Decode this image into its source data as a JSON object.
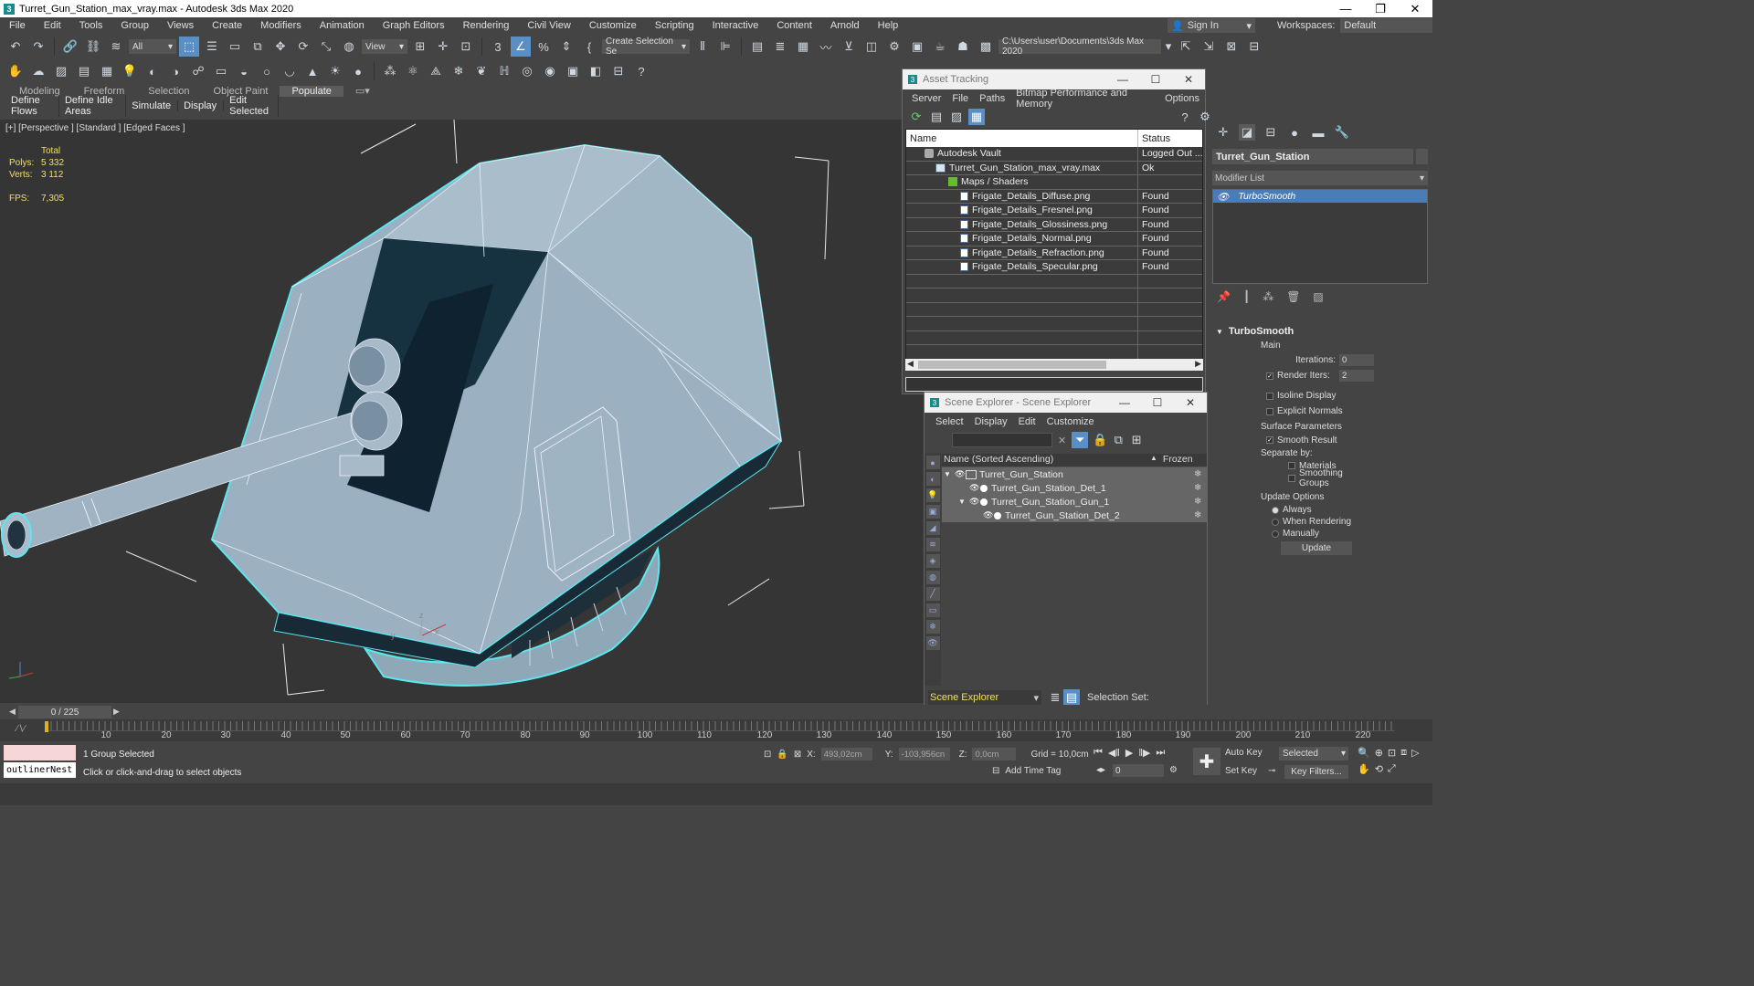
{
  "title_bar": {
    "app_icon": "3",
    "title": "Turret_Gun_Station_max_vray.max - Autodesk 3ds Max 2020",
    "min": "—",
    "restore": "❐",
    "close": "✕"
  },
  "menu": {
    "items": [
      "File",
      "Edit",
      "Tools",
      "Group",
      "Views",
      "Create",
      "Modifiers",
      "Animation",
      "Graph Editors",
      "Rendering",
      "Civil View",
      "Customize",
      "Scripting",
      "Interactive",
      "Content",
      "Arnold",
      "Help"
    ],
    "sign_in": "Sign In",
    "workspaces_label": "Workspaces:",
    "workspace_value": "Default"
  },
  "toolbar": {
    "selection_filter": "All",
    "ref_coord": "View",
    "named_selection": "Create Selection Se",
    "project_path": "C:\\Users\\user\\Documents\\3ds Max 2020"
  },
  "ribbon": {
    "tabs": [
      "Modeling",
      "Freeform",
      "Selection",
      "Object Paint",
      "Populate"
    ],
    "active_tab": "Populate",
    "sub_items": [
      "Define Flows",
      "Define Idle Areas",
      "Simulate",
      "Display",
      "Edit Selected"
    ]
  },
  "viewport": {
    "label": "[+] [Perspective ] [Standard ] [Edged Faces ]",
    "stats_header": "Total",
    "polys_label": "Polys:",
    "polys_value": "5 332",
    "verts_label": "Verts:",
    "verts_value": "3 112",
    "fps_label": "FPS:",
    "fps_value": "7,305",
    "axis_z": "z",
    "axis_x": "x",
    "axis_y": "y"
  },
  "asset_tracking": {
    "title": "Asset Tracking",
    "menu": [
      "Server",
      "File",
      "Paths",
      "Bitmap Performance and Memory",
      "Options"
    ],
    "col_name": "Name",
    "col_status": "Status",
    "rows": [
      {
        "name": "Autodesk Vault",
        "status": "Logged Out ..."
      },
      {
        "name": "Turret_Gun_Station_max_vray.max",
        "status": "Ok"
      },
      {
        "name": "Maps / Shaders",
        "status": ""
      },
      {
        "name": "Frigate_Details_Diffuse.png",
        "status": "Found"
      },
      {
        "name": "Frigate_Details_Fresnel.png",
        "status": "Found"
      },
      {
        "name": "Frigate_Details_Glossiness.png",
        "status": "Found"
      },
      {
        "name": "Frigate_Details_Normal.png",
        "status": "Found"
      },
      {
        "name": "Frigate_Details_Refraction.png",
        "status": "Found"
      },
      {
        "name": "Frigate_Details_Specular.png",
        "status": "Found"
      }
    ]
  },
  "scene_explorer": {
    "title": "Scene Explorer - Scene Explorer",
    "menu": [
      "Select",
      "Display",
      "Edit",
      "Customize"
    ],
    "col_name": "Name (Sorted Ascending)",
    "col_frozen": "Frozen",
    "rows": [
      {
        "name": "Turret_Gun_Station",
        "indent": 0
      },
      {
        "name": "Turret_Gun_Station_Det_1",
        "indent": 1
      },
      {
        "name": "Turret_Gun_Station_Gun_1",
        "indent": 1
      },
      {
        "name": "Turret_Gun_Station_Det_2",
        "indent": 2
      }
    ],
    "explorer_name": "Scene Explorer",
    "selection_set_label": "Selection Set:"
  },
  "command_panel": {
    "object_name": "Turret_Gun_Station",
    "modifier_list": "Modifier List",
    "stack_item": "TurboSmooth",
    "rollout_title": "TurboSmooth",
    "main_label": "Main",
    "iterations_label": "Iterations:",
    "iterations_value": "0",
    "render_iters_label": "Render Iters:",
    "render_iters_value": "2",
    "isoline_label": "Isoline Display",
    "explicit_label": "Explicit Normals",
    "surface_label": "Surface Parameters",
    "smooth_label": "Smooth Result",
    "separate_label": "Separate by:",
    "materials_label": "Materials",
    "smoothing_label": "Smoothing Groups",
    "update_options_label": "Update Options",
    "always_label": "Always",
    "when_rendering_label": "When Rendering",
    "manually_label": "Manually",
    "update_button": "Update"
  },
  "timeline": {
    "frame_display": "0 / 225",
    "labels": [
      "10",
      "20",
      "30",
      "40",
      "50",
      "60",
      "70",
      "80",
      "90",
      "100",
      "110",
      "120",
      "130",
      "140",
      "150",
      "160",
      "170",
      "180",
      "190",
      "200",
      "210",
      "220"
    ]
  },
  "status": {
    "listener": "outlinerNest",
    "selected": "1 Group Selected",
    "prompt": "Click or click-and-drag to select objects",
    "x_label": "X:",
    "x_value": "493,02cm",
    "y_label": "Y:",
    "y_value": "-103,956cn",
    "z_label": "Z:",
    "z_value": "0,0cm",
    "grid": "Grid = 10,0cm",
    "add_time_tag": "Add Time Tag",
    "frame": "0",
    "auto_key": "Auto Key",
    "set_key": "Set Key",
    "selected_dropdown": "Selected",
    "key_filters": "Key Filters..."
  }
}
